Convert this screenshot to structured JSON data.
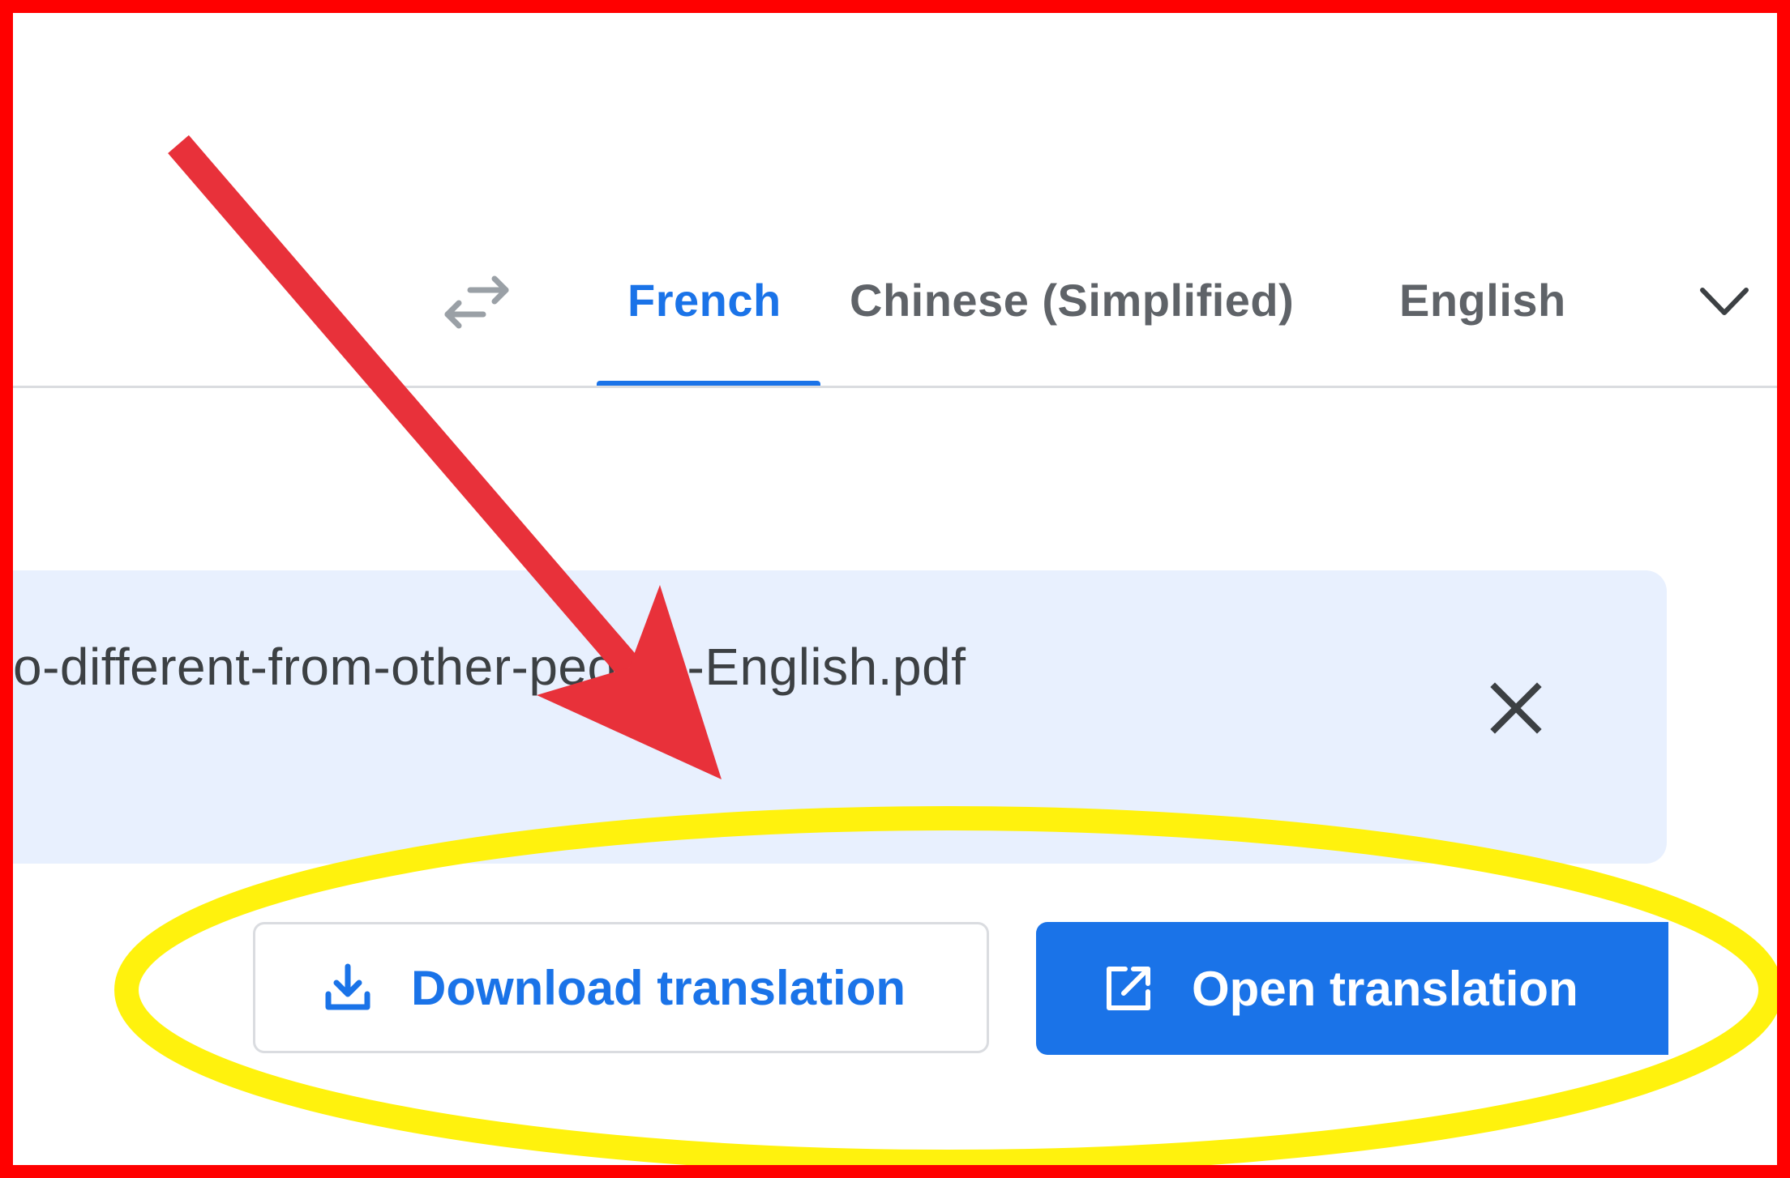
{
  "language_bar": {
    "tabs": [
      {
        "label": "French",
        "active": true
      },
      {
        "label": "Chinese (Simplified)",
        "active": false
      },
      {
        "label": "English",
        "active": false
      }
    ],
    "swap_icon": "swap-arrows-icon",
    "more_icon": "chevron-down-icon"
  },
  "file": {
    "name": "o-different-from-other-people-English.pdf",
    "close_icon": "close-icon"
  },
  "actions": {
    "download_label": "Download translation",
    "download_icon": "download-icon",
    "open_label": "Open translation",
    "open_icon": "open-in-new-icon"
  },
  "annotations": {
    "arrow_color": "#e8313a",
    "ellipse_color": "#fff20d",
    "frame_color": "#ff0000"
  },
  "colors": {
    "accent": "#1a73e8",
    "card_bg": "#e8f0fe",
    "text_muted": "#5f6368"
  }
}
